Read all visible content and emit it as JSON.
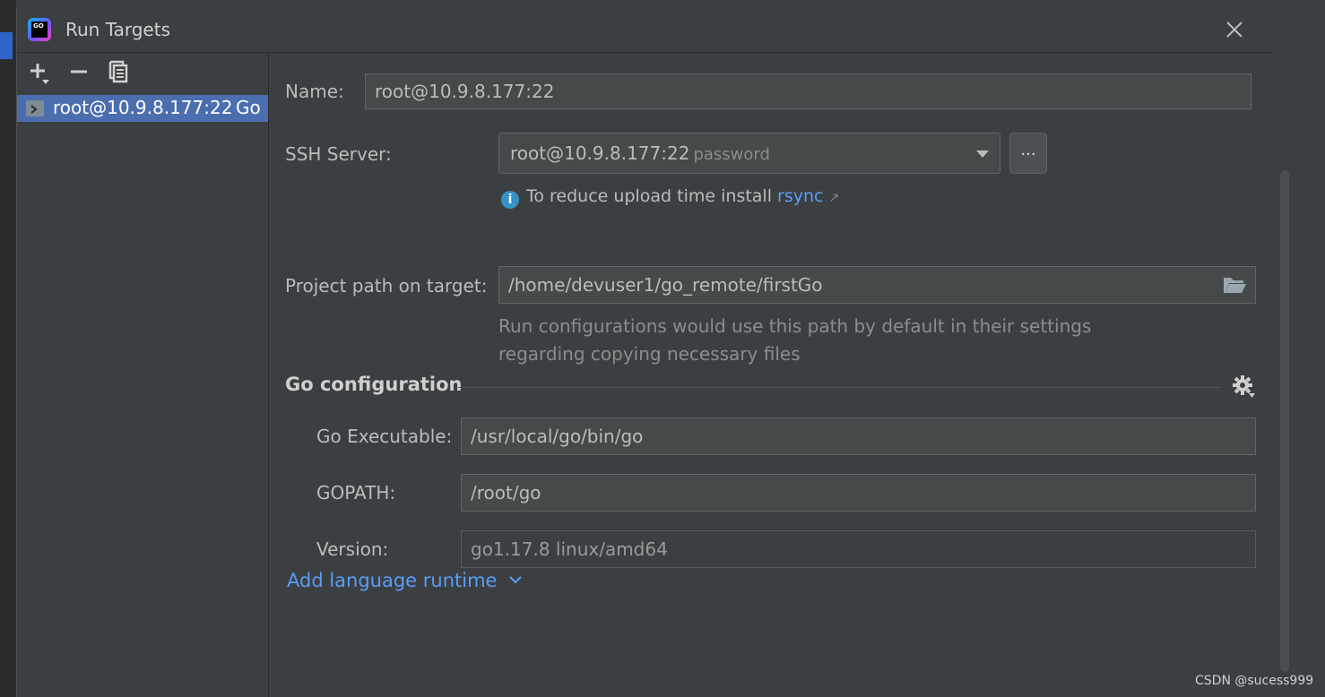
{
  "dialog": {
    "title": "Run Targets",
    "app_logo_text": "GO"
  },
  "sidebar": {
    "items": [
      {
        "label": "root@10.9.8.177:22",
        "type": "Go"
      }
    ]
  },
  "form": {
    "name_label": "Name:",
    "name_value": "root@10.9.8.177:22",
    "ssh_label": "SSH Server:",
    "ssh_value": "root@10.9.8.177:22",
    "ssh_hint": "password",
    "more_button": "...",
    "rsync_info_prefix": "To reduce upload time install",
    "rsync_link": "rsync",
    "project_path_label": "Project path on target:",
    "project_path_value": "/home/devuser1/go_remote/firstGo",
    "project_path_hint_line1": "Run configurations would use this path by default in their settings",
    "project_path_hint_line2": "regarding copying necessary files"
  },
  "go_config": {
    "section_title": "Go configuration",
    "executable_label": "Go Executable:",
    "executable_value": "/usr/local/go/bin/go",
    "gopath_label": "GOPATH:",
    "gopath_value": "/root/go",
    "version_label": "Version:",
    "version_value": "go1.17.8 linux/amd64",
    "add_runtime_label": "Add language runtime"
  },
  "watermark": "CSDN @sucess999",
  "colors": {
    "background": "#3c3f41",
    "selection": "#4b6eaf",
    "link": "#589df6",
    "info": "#3592c4"
  }
}
